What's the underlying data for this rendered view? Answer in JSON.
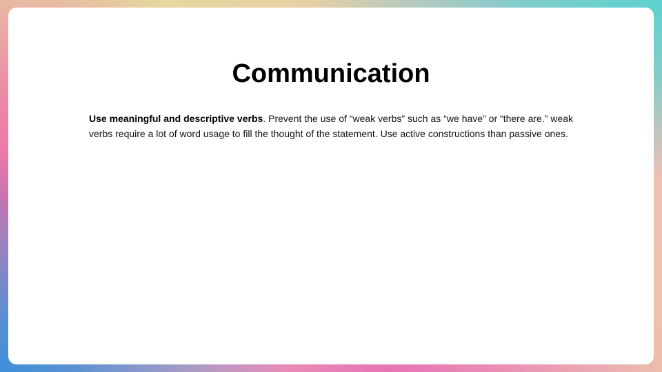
{
  "slide": {
    "title": "Communication",
    "paragraph": {
      "lead": "Use meaningful and descriptive verbs",
      "text": ". Prevent the use of “weak verbs” such as “we have” or “there are.” weak verbs require a lot of word usage to fill the thought of the statement. Use active constructions than passive ones."
    }
  }
}
